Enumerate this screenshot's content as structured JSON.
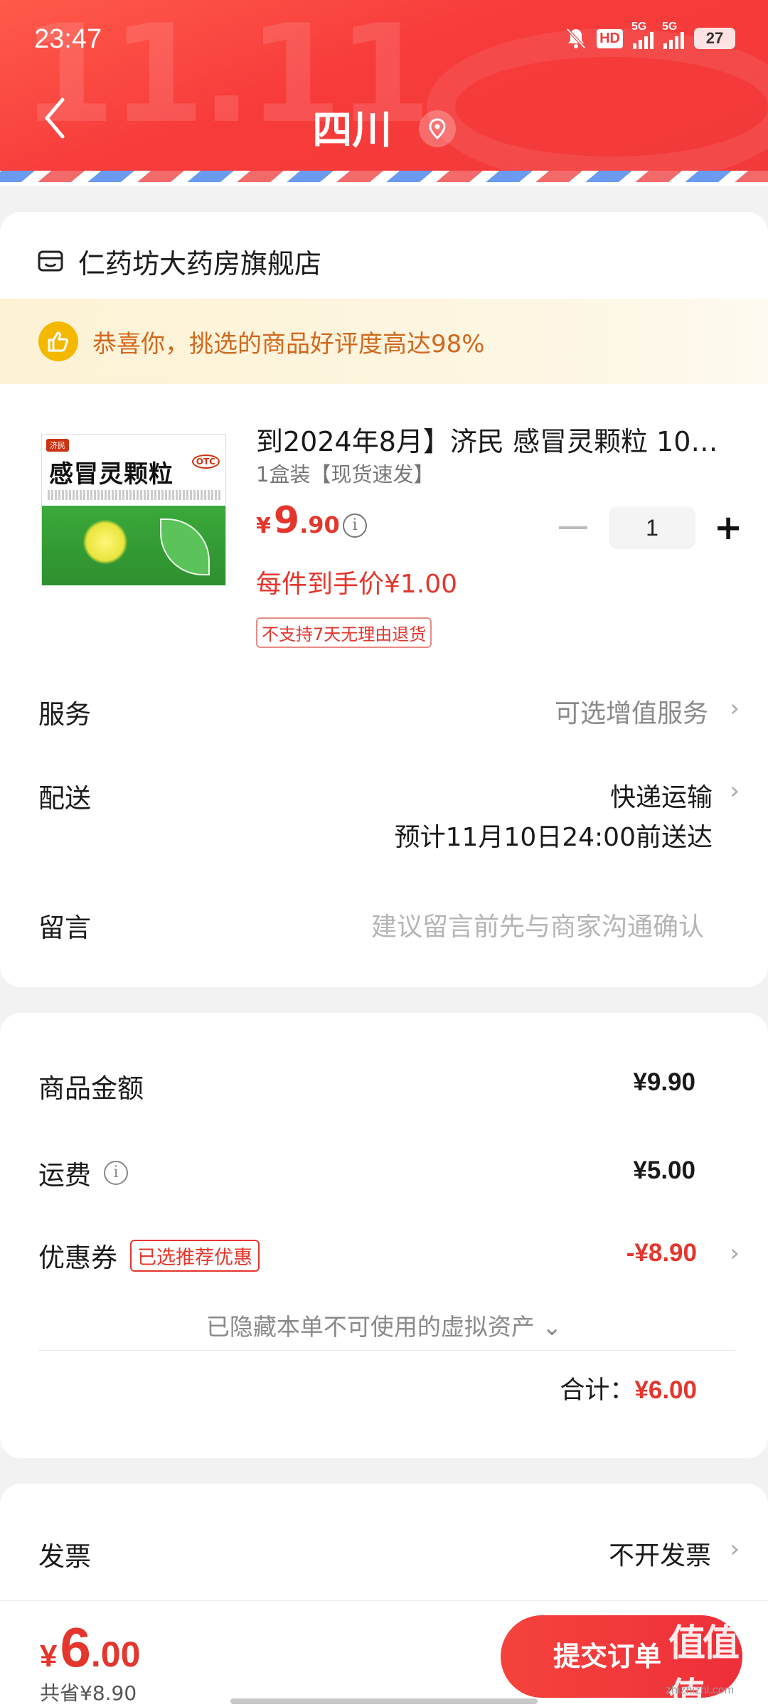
{
  "status_bar": {
    "time": "23:47",
    "hd_label": "HD",
    "sim1_label": "5G",
    "sim2_label": "5G",
    "battery": "27"
  },
  "header": {
    "watermark": "11.11",
    "title": "四川"
  },
  "shop": {
    "name": "仁药坊大药房旗舰店"
  },
  "banner": {
    "text": "恭喜你，挑选的商品好评度高达98%"
  },
  "product": {
    "box_brand": "济民",
    "box_name": "感冒灵颗粒",
    "box_otc": "OTC",
    "title": "到2024年8月】济民 感冒灵颗粒 10…",
    "spec": "1盒装【现货速发】",
    "price_symbol": "¥",
    "price_int": "9",
    "price_dec": ".90",
    "info_icon": "i",
    "quantity": "1",
    "unit_price": "每件到手价¥1.00",
    "return_tag": "不支持7天无理由退货"
  },
  "rows": {
    "service_label": "服务",
    "service_value": "可选增值服务",
    "delivery_label": "配送",
    "delivery_value": "快递运输",
    "delivery_eta": "预计11月10日24:00前送达",
    "message_label": "留言",
    "message_placeholder": "建议留言前先与商家沟通确认"
  },
  "summary": {
    "goods_label": "商品金额",
    "goods_value": "¥9.90",
    "shipping_label": "运费",
    "shipping_value": "¥5.00",
    "coupon_label": "优惠券",
    "coupon_tag": "已选推荐优惠",
    "coupon_value": "-¥8.90",
    "hidden_note": "已隐藏本单不可使用的虚拟资产 ⌄",
    "total_label": "合计：",
    "total_value": "¥6.00"
  },
  "invoice": {
    "label": "发票",
    "value": "不开发票"
  },
  "bottom": {
    "price_symbol": "¥",
    "price_int": "6",
    "price_dec": ".00",
    "saved": "共省¥8.90",
    "submit_label": "提交订单",
    "watermark": "值值值",
    "watermark_sub": "zhizhizhi.com"
  },
  "colors": {
    "brand_red": "#e4362c",
    "header_red": "#f73b3b",
    "banner_text": "#d0691e"
  }
}
